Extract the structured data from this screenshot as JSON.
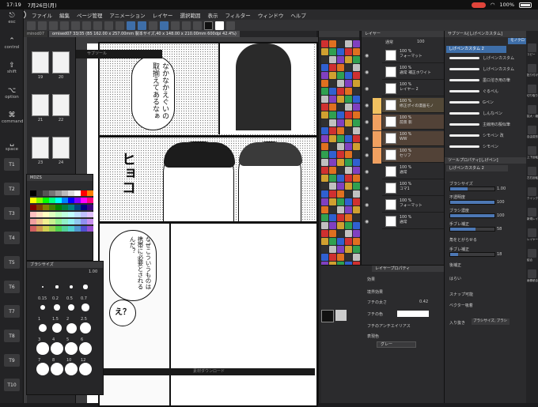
{
  "status": {
    "time": "17:19",
    "date": "7月26日(月)",
    "battery": "100%"
  },
  "menu": {
    "items": [
      "ファイル",
      "編集",
      "ページ管理",
      "アニメーション",
      "レイヤー",
      "選択範囲",
      "表示",
      "フィルター",
      "ウィンドウ",
      "ヘルプ"
    ]
  },
  "shortcuts": {
    "modifiers": [
      {
        "label": "esc",
        "sym": "⎋"
      },
      {
        "label": "control",
        "sym": "⌃"
      },
      {
        "label": "shift",
        "sym": "⇧"
      },
      {
        "label": "option",
        "sym": "⌥"
      },
      {
        "label": "command",
        "sym": "⌘"
      },
      {
        "label": "space",
        "sym": "␣"
      }
    ],
    "keys": [
      "T1",
      "T2",
      "T3",
      "T4",
      "T5",
      "T6",
      "T7",
      "T8",
      "T9",
      "T10"
    ]
  },
  "tabs": [
    "minod07",
    "omised07 33/35 (B5 162.00 x 257.00mm 製本サイズ,40 ⅹ 148.00 x 210.00mm 600dpi 42.4%)"
  ],
  "pages": [
    {
      "num": "19"
    },
    {
      "num": "20"
    },
    {
      "num": "21"
    },
    {
      "num": "22"
    },
    {
      "num": "23"
    },
    {
      "num": "24"
    }
  ],
  "manga": {
    "balloon1": "なかなかえぐいの取揃えてあるなぁ",
    "sfx": "ヒョコ",
    "balloon2": "なぜこういうものは携帯に必要とされるんだ？",
    "balloon3": "え？",
    "float_title": "サブツール",
    "download_bar": "素材ダウンロード"
  },
  "colorset": {
    "title": "MDZS"
  },
  "brushsize": {
    "title": "ブラシサイズ",
    "value": "1.00",
    "labels": [
      "0.15",
      "0.2",
      "0.5",
      "0.7",
      "1",
      "1.5",
      "2",
      "2.5",
      "3",
      "4",
      "5",
      "6",
      "7",
      "8",
      "10",
      "12"
    ]
  },
  "layers": {
    "title": "レイヤー",
    "blend": "通常",
    "opacity": "100",
    "rows": [
      {
        "pct": "100 %",
        "name": "フォーマット"
      },
      {
        "pct": "100 %",
        "name": "通常\n補正ホワイト"
      },
      {
        "pct": "100 %",
        "name": "レイヤー 2"
      },
      {
        "pct": "100 %",
        "name": "修正ポイの漫画モノ"
      },
      {
        "pct": "100 %",
        "name": "前景 影"
      },
      {
        "pct": "100 %",
        "name": "WW"
      },
      {
        "pct": "100 %",
        "name": "セリフ"
      },
      {
        "pct": "100 %",
        "name": "通常"
      },
      {
        "pct": "100 %",
        "name": "コマ1"
      },
      {
        "pct": "100 %",
        "name": "フォーマット"
      },
      {
        "pct": "100 %",
        "name": "通常"
      }
    ]
  },
  "layerprop": {
    "title": "レイヤープロパティ",
    "effect": "効果",
    "border_effect": "境界効果",
    "edge_width_label": "フチの太さ",
    "edge_width": "0.42",
    "edge_color_label": "フチの色",
    "antialias": "フチのアンチエイリアス",
    "expr_label": "表現色",
    "expr_value": "グレー"
  },
  "subtool": {
    "title": "サブツール[しげペンカスタム]",
    "tab": "モノクロ",
    "selected": "しげペンカスタム 2",
    "brushes": [
      "しげペンカスタム",
      "しげペンカスタム",
      "墨ロ溶き用の筆",
      "ぐるぺん",
      "Gペン",
      "しんなペン",
      "主線用の擬似筆",
      "シモペン 改",
      "シモペン"
    ]
  },
  "toolprop": {
    "title": "ツールプロパティ[しげペン]",
    "name": "しげペンカスタム 2",
    "brush_size_label": "ブラシサイズ",
    "brush_size": "1.00",
    "opacity_label": "不透明度",
    "opacity": "100",
    "density_label": "ブラシ濃度",
    "density": "100",
    "stabilize_label": "手ブレ補正",
    "stabilize": "58",
    "corner_label": "角をとがらせる",
    "correction_label": "手ブレ補正",
    "correction": "18",
    "post_correction": "後補正",
    "start_end": "はらい",
    "snap": "スナップ可能",
    "vector": "ベクター吸着",
    "in_out": "入り抜き",
    "in_out_value": "ブラシサイズ, ブラシ"
  },
  "rightcmd": [
    "コピー",
    "貼り付け",
    "切り取り",
    "拡大・縮小",
    "自由変形",
    "上下反転",
    "左右反転",
    "クイック",
    "新規レイヤー",
    "レイヤー複製",
    "結合",
    "画像統合"
  ]
}
